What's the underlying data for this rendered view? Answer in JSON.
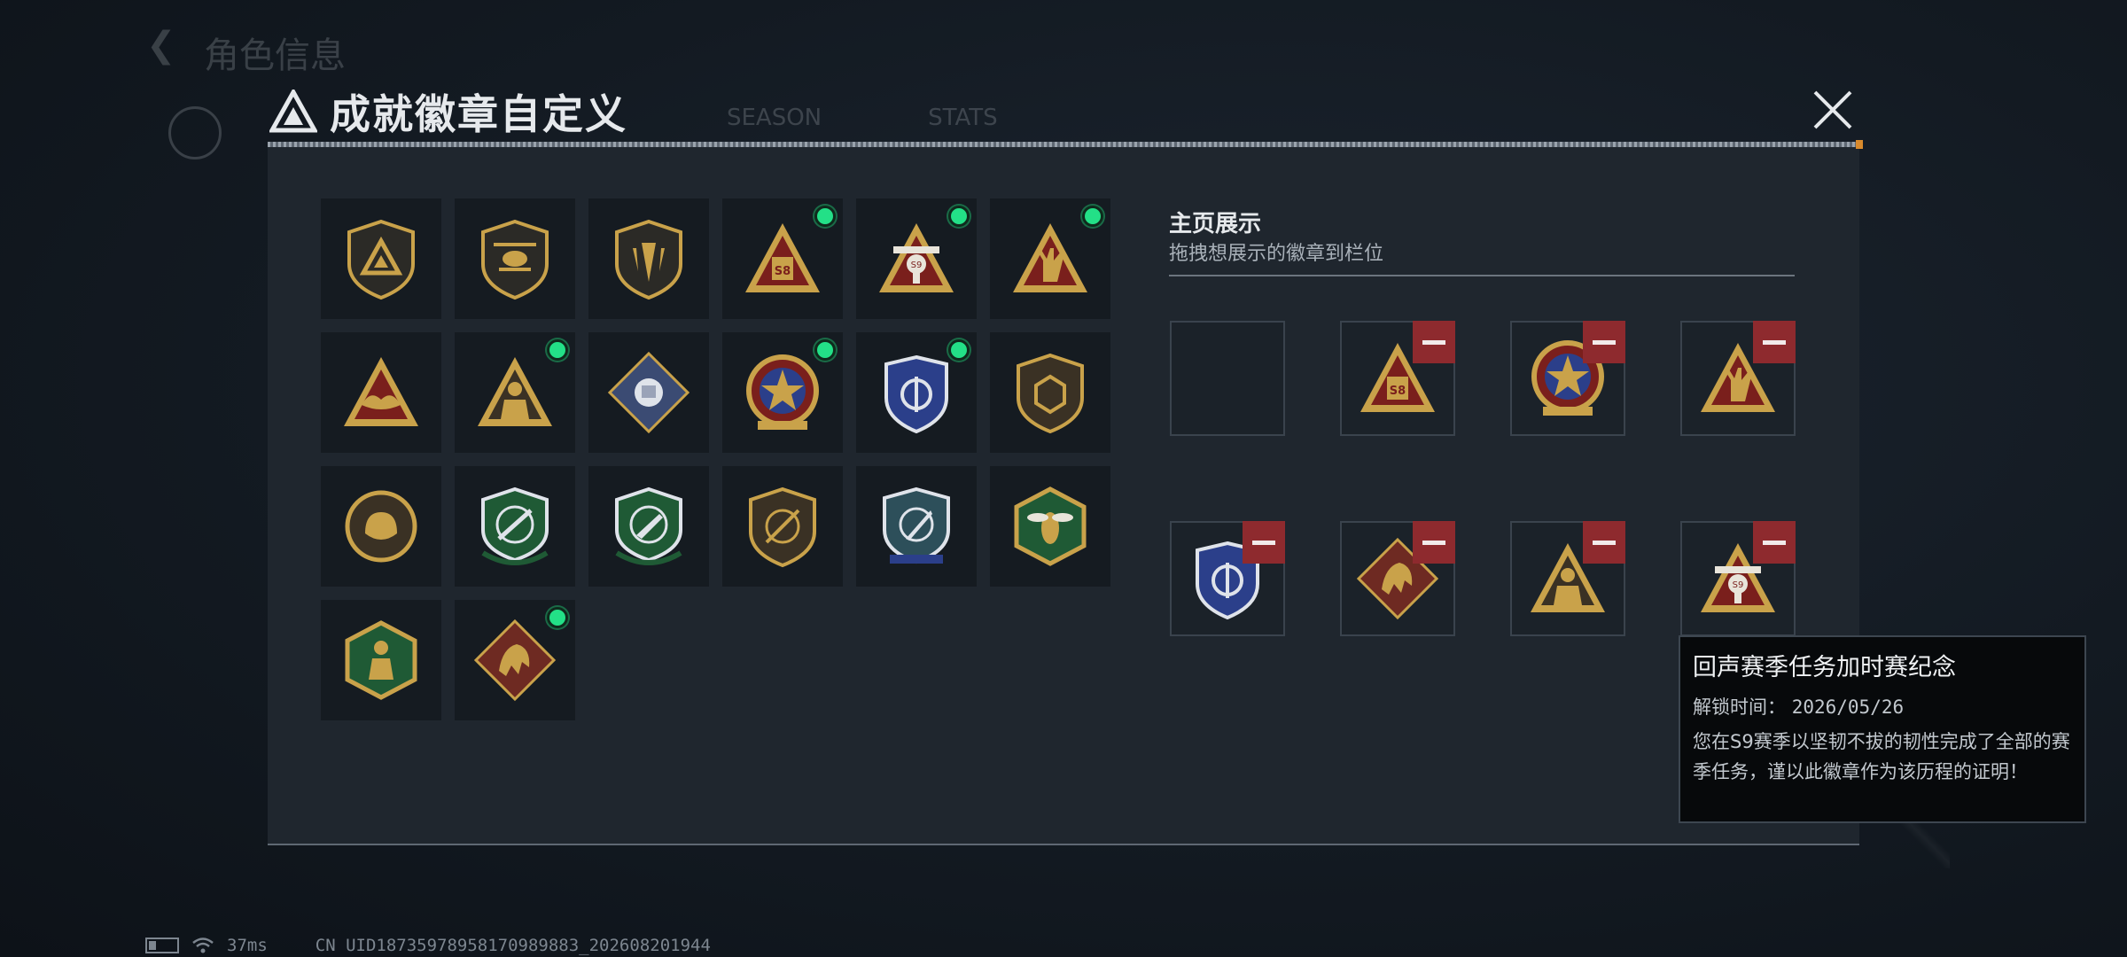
{
  "background": {
    "back_title": "角色信息",
    "tabs": [
      "SEASON",
      "STATS"
    ]
  },
  "modal": {
    "title": "成就徽章自定义",
    "close_icon": "close-x-icon"
  },
  "badge_grid": [
    {
      "icon": "shield-triangle-logo-badge",
      "new": false
    },
    {
      "icon": "shield-helicopter-badge",
      "new": false
    },
    {
      "icon": "shield-dagger-badge",
      "new": false
    },
    {
      "icon": "triangle-s8-badge",
      "new": true
    },
    {
      "icon": "triangle-s9-robot-badge",
      "new": true
    },
    {
      "icon": "triangle-hand-sign-badge",
      "new": true
    },
    {
      "icon": "triangle-bird-badge",
      "new": false
    },
    {
      "icon": "triangle-soldier-badge",
      "new": true
    },
    {
      "icon": "diamond-fist-badge",
      "new": false
    },
    {
      "icon": "star-medal-badge",
      "new": true
    },
    {
      "icon": "blue-shield-badge",
      "new": true
    },
    {
      "icon": "shield-dice-badge",
      "new": false
    },
    {
      "icon": "round-beast-badge",
      "new": false
    },
    {
      "icon": "green-crosshair-rifle-badge",
      "new": false
    },
    {
      "icon": "green-crosshair-pistol-badge",
      "new": false
    },
    {
      "icon": "shield-crosshair-badge",
      "new": false
    },
    {
      "icon": "blue-knife-shield-badge",
      "new": false
    },
    {
      "icon": "hexagon-wasp-badge",
      "new": false
    },
    {
      "icon": "hexagon-figure-badge",
      "new": false
    },
    {
      "icon": "diamond-dragon-badge",
      "new": true
    }
  ],
  "showcase": {
    "title": "主页展示",
    "subtitle": "拖拽想展示的徽章到栏位",
    "slots": [
      {
        "icon": "",
        "removable": false
      },
      {
        "icon": "triangle-s8-badge",
        "removable": true
      },
      {
        "icon": "star-medal-badge",
        "removable": true
      },
      {
        "icon": "triangle-hand-sign-badge",
        "removable": true
      },
      {
        "icon": "blue-shield-badge",
        "removable": true
      },
      {
        "icon": "diamond-dragon-badge",
        "removable": true
      },
      {
        "icon": "triangle-soldier-badge",
        "removable": true
      },
      {
        "icon": "triangle-s9-robot-badge",
        "removable": true
      }
    ]
  },
  "tooltip": {
    "title": "回声赛季任务加时赛纪念",
    "unlock_label": "解锁时间：",
    "unlock_value": "2026/05/26",
    "description": "您在S9赛季以坚韧不拔的韧性完成了全部的赛季任务，谨以此徽章作为该历程的证明！"
  },
  "status": {
    "ping": "37ms",
    "uid": "CN UID18735978958170989883_202608201944"
  },
  "colors": {
    "new_indicator": "#23e087",
    "remove_button": "#8e2a2e",
    "gold": "#c9a24a",
    "red_field": "#7a1f1c",
    "blue_field": "#2b3f8a",
    "green_field": "#1f5a35"
  }
}
